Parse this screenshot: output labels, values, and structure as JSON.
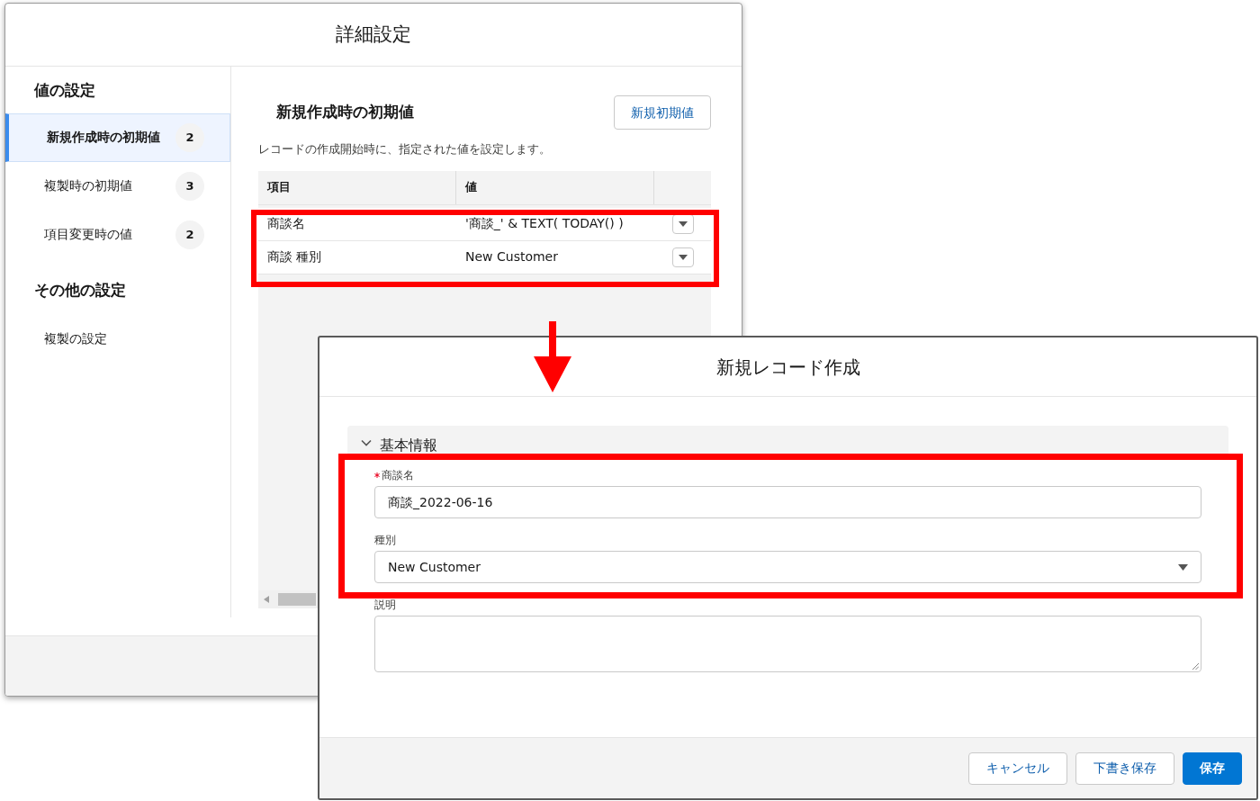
{
  "settings_dialog": {
    "title": "詳細設定",
    "sidebar": [
      {
        "heading": "値の設定",
        "items": [
          {
            "label": "新規作成時の初期値",
            "count": "2",
            "selected": true
          },
          {
            "label": "複製時の初期値",
            "count": "3",
            "selected": false
          },
          {
            "label": "項目変更時の値",
            "count": "2",
            "selected": false
          }
        ]
      },
      {
        "heading": "その他の設定",
        "items": [
          {
            "label": "複製の設定",
            "selected": false
          }
        ]
      }
    ],
    "content": {
      "title": "新規作成時の初期値",
      "new_button": "新規初期値",
      "description": "レコードの作成開始時に、指定された値を設定します。",
      "table": {
        "columns": [
          "項目",
          "値"
        ],
        "rows": [
          {
            "field": "商談名",
            "value": "'商談_' & TEXT( TODAY() )"
          },
          {
            "field": "商談 種別",
            "value": "New Customer"
          }
        ]
      }
    }
  },
  "record_dialog": {
    "title": "新規レコード作成",
    "section": {
      "title": "基本情報",
      "expanded": true
    },
    "fields": [
      {
        "kind": "text",
        "label": "商談名",
        "required": true,
        "value": "商談_2022-06-16"
      },
      {
        "kind": "select",
        "label": "種別",
        "required": false,
        "value": "New Customer"
      },
      {
        "kind": "textarea",
        "label": "説明",
        "required": false
      }
    ],
    "buttons": [
      {
        "label": "キャンセル",
        "kind": "neutral"
      },
      {
        "label": "下書き保存",
        "kind": "neutral"
      },
      {
        "label": "保存",
        "kind": "brand"
      }
    ]
  }
}
